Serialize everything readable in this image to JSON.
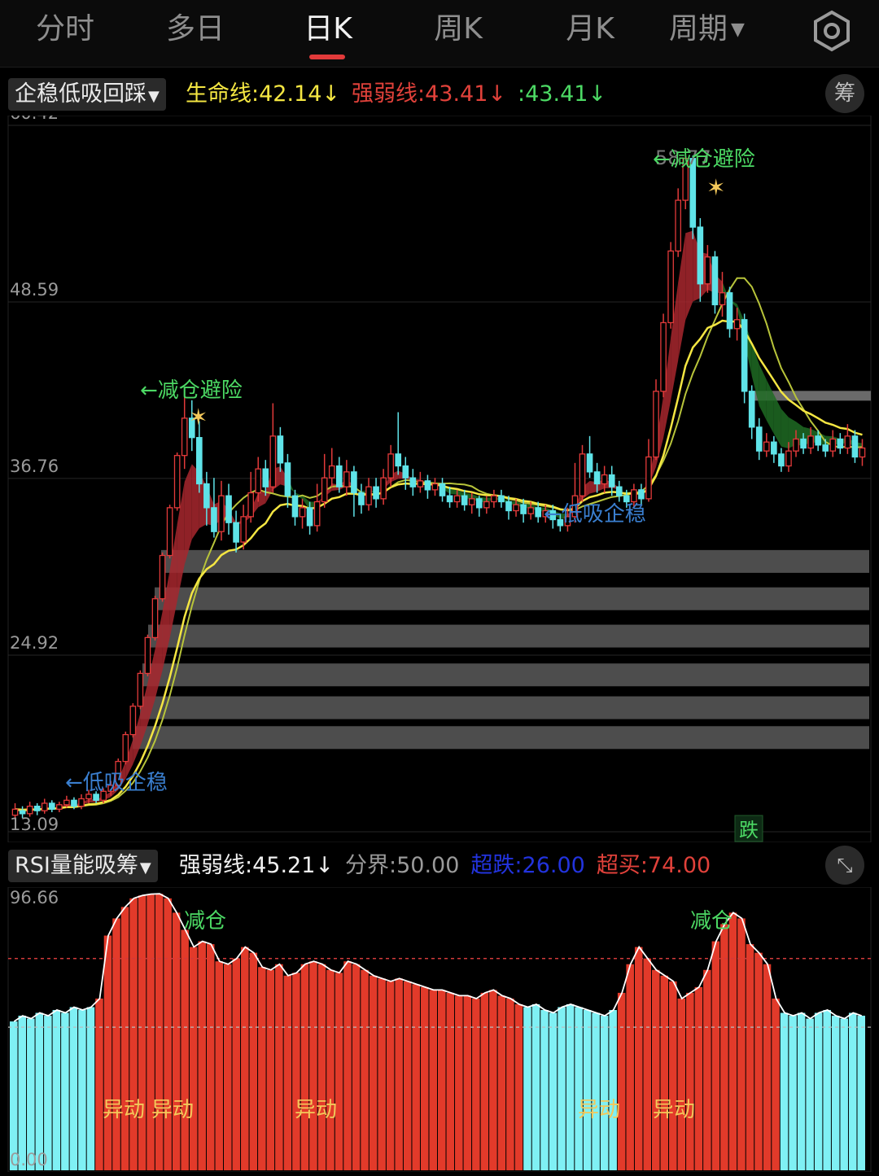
{
  "tabs": [
    {
      "label": "分时",
      "active": false
    },
    {
      "label": "多日",
      "active": false
    },
    {
      "label": "日K",
      "active": true
    },
    {
      "label": "周K",
      "active": false
    },
    {
      "label": "月K",
      "active": false
    },
    {
      "label": "周期",
      "active": false
    }
  ],
  "main_indicator": {
    "selector": "企稳低吸回踩",
    "values": [
      {
        "text": "生命线:42.14↓",
        "color": "#f4e642"
      },
      {
        "text": "强弱线:43.41↓",
        "color": "#e0413a"
      },
      {
        "text": ":43.41↓",
        "color": "#4cd964"
      }
    ],
    "chip_label": "筹"
  },
  "sub_indicator": {
    "selector": "RSI量能吸筹",
    "values": [
      {
        "text": "强弱线:45.21↓",
        "color": "#f0f0f0"
      },
      {
        "text": "分界:50.00",
        "color": "#9a9a9a"
      },
      {
        "text": "超跌:26.00",
        "color": "#2233dd"
      },
      {
        "text": "超买:74.00",
        "color": "#e0413a"
      }
    ]
  },
  "price_axis": [
    "60.42",
    "48.59",
    "36.76",
    "24.92",
    "13.09"
  ],
  "rsi_axis": [
    "96.66",
    "0.00"
  ],
  "annotations": {
    "high_price": "58.77",
    "reduce_label": "←减仓避险",
    "low_buy_label": "←低吸企稳",
    "fall_label": "跌",
    "rsi_reduce": "减仓",
    "rsi_move": "异动"
  },
  "chart_data": {
    "type": "candlestick",
    "price_range": [
      13.09,
      60.42
    ],
    "rsi_range": [
      0,
      96.66
    ],
    "rsi_levels": {
      "boundary": 50,
      "oversold": 26,
      "overbought": 74
    },
    "candles": [
      [
        14.2,
        14.6,
        15.0,
        13.9
      ],
      [
        14.5,
        14.3,
        14.8,
        14.0
      ],
      [
        14.3,
        14.8,
        15.1,
        14.1
      ],
      [
        14.8,
        14.5,
        15.0,
        14.2
      ],
      [
        14.5,
        15.0,
        15.3,
        14.3
      ],
      [
        15.0,
        14.6,
        15.2,
        14.4
      ],
      [
        14.6,
        14.9,
        15.1,
        14.4
      ],
      [
        14.9,
        15.2,
        15.5,
        14.7
      ],
      [
        15.2,
        14.8,
        15.4,
        14.6
      ],
      [
        14.8,
        15.3,
        15.6,
        14.6
      ],
      [
        15.3,
        15.6,
        15.9,
        15.0
      ],
      [
        15.6,
        15.2,
        15.8,
        15.0
      ],
      [
        15.2,
        15.8,
        16.0,
        15.0
      ],
      [
        15.8,
        16.2,
        16.5,
        15.5
      ],
      [
        16.2,
        17.8,
        18.0,
        16.0
      ],
      [
        17.8,
        19.6,
        19.8,
        17.6
      ],
      [
        19.6,
        21.5,
        21.7,
        19.4
      ],
      [
        21.5,
        23.7,
        23.9,
        21.3
      ],
      [
        23.7,
        26.1,
        26.3,
        23.5
      ],
      [
        26.1,
        28.7,
        28.9,
        25.9
      ],
      [
        28.7,
        31.6,
        31.8,
        28.5
      ],
      [
        31.6,
        34.8,
        35.0,
        31.4
      ],
      [
        34.8,
        38.3,
        38.5,
        34.6
      ],
      [
        38.3,
        40.8,
        42.6,
        37.4
      ],
      [
        40.8,
        39.5,
        42.0,
        38.6
      ],
      [
        39.5,
        36.4,
        40.6,
        35.8
      ],
      [
        36.4,
        34.8,
        37.2,
        33.6
      ],
      [
        34.8,
        33.2,
        36.8,
        32.8
      ],
      [
        33.2,
        35.6,
        36.6,
        32.6
      ],
      [
        35.6,
        33.8,
        36.4,
        33.0
      ],
      [
        33.8,
        32.5,
        34.6,
        31.8
      ],
      [
        32.5,
        34.2,
        35.0,
        32.0
      ],
      [
        34.2,
        35.8,
        37.2,
        33.8
      ],
      [
        35.8,
        37.4,
        38.2,
        35.2
      ],
      [
        37.4,
        36.2,
        38.0,
        35.6
      ],
      [
        36.2,
        39.6,
        41.8,
        35.8
      ],
      [
        39.6,
        37.8,
        40.2,
        37.2
      ],
      [
        37.8,
        35.6,
        38.4,
        34.8
      ],
      [
        35.6,
        34.2,
        36.0,
        33.6
      ],
      [
        34.2,
        34.8,
        35.4,
        33.4
      ],
      [
        34.8,
        33.6,
        35.2,
        33.0
      ],
      [
        33.6,
        35.2,
        36.4,
        33.2
      ],
      [
        35.2,
        36.8,
        38.4,
        34.8
      ],
      [
        36.8,
        37.6,
        38.8,
        36.2
      ],
      [
        37.6,
        36.2,
        38.2,
        35.8
      ],
      [
        36.2,
        37.2,
        38.0,
        35.6
      ],
      [
        37.2,
        35.8,
        37.6,
        34.2
      ],
      [
        35.8,
        35.0,
        36.4,
        34.4
      ],
      [
        35.0,
        36.2,
        36.8,
        34.6
      ],
      [
        36.2,
        35.4,
        36.8,
        34.8
      ],
      [
        35.4,
        36.8,
        37.4,
        35.0
      ],
      [
        36.8,
        38.4,
        39.0,
        36.2
      ],
      [
        38.4,
        37.6,
        41.2,
        37.0
      ],
      [
        37.6,
        36.8,
        38.2,
        36.0
      ],
      [
        36.8,
        36.2,
        37.4,
        35.6
      ],
      [
        36.2,
        36.6,
        37.2,
        35.8
      ],
      [
        36.6,
        36.0,
        37.0,
        35.4
      ],
      [
        36.0,
        36.4,
        36.8,
        35.6
      ],
      [
        36.4,
        35.6,
        36.8,
        35.2
      ],
      [
        35.6,
        35.2,
        36.2,
        34.8
      ],
      [
        35.2,
        35.6,
        36.0,
        34.8
      ],
      [
        35.6,
        35.0,
        36.0,
        34.6
      ],
      [
        35.0,
        35.4,
        35.8,
        34.4
      ],
      [
        35.4,
        34.8,
        35.6,
        34.2
      ],
      [
        34.8,
        35.2,
        35.6,
        34.4
      ],
      [
        35.2,
        35.6,
        36.0,
        34.8
      ],
      [
        35.6,
        35.2,
        36.0,
        34.8
      ],
      [
        35.2,
        34.6,
        35.6,
        34.0
      ],
      [
        34.6,
        35.0,
        35.4,
        34.2
      ],
      [
        35.0,
        34.4,
        35.4,
        33.8
      ],
      [
        34.4,
        34.8,
        35.2,
        34.0
      ],
      [
        34.8,
        34.2,
        35.2,
        33.8
      ],
      [
        34.2,
        34.6,
        35.0,
        33.8
      ],
      [
        34.6,
        34.0,
        35.0,
        33.4
      ],
      [
        34.0,
        33.6,
        34.4,
        33.2
      ],
      [
        33.6,
        34.2,
        34.8,
        33.2
      ],
      [
        34.2,
        35.6,
        37.8,
        33.8
      ],
      [
        35.6,
        38.4,
        39.0,
        35.2
      ],
      [
        38.4,
        37.2,
        39.6,
        36.8
      ],
      [
        37.2,
        36.4,
        37.8,
        35.8
      ],
      [
        36.4,
        37.0,
        37.6,
        35.8
      ],
      [
        37.0,
        36.2,
        37.6,
        35.6
      ],
      [
        36.2,
        35.6,
        36.6,
        35.2
      ],
      [
        35.6,
        35.2,
        36.0,
        34.8
      ],
      [
        35.2,
        36.0,
        36.4,
        34.8
      ],
      [
        36.0,
        35.4,
        36.4,
        35.0
      ],
      [
        35.4,
        38.2,
        39.4,
        35.2
      ],
      [
        38.2,
        42.6,
        43.4,
        38.0
      ],
      [
        42.6,
        47.2,
        47.8,
        42.2
      ],
      [
        47.2,
        52.0,
        52.6,
        46.8
      ],
      [
        52.0,
        55.4,
        56.2,
        51.6
      ],
      [
        55.4,
        58.2,
        58.77,
        54.8
      ],
      [
        58.2,
        53.6,
        58.4,
        52.8
      ],
      [
        53.6,
        49.8,
        54.2,
        48.6
      ],
      [
        49.8,
        51.6,
        52.4,
        49.2
      ],
      [
        51.6,
        48.4,
        52.0,
        47.8
      ],
      [
        48.4,
        49.2,
        50.6,
        47.6
      ],
      [
        49.2,
        46.8,
        49.6,
        46.2
      ],
      [
        46.8,
        47.4,
        48.2,
        46.0
      ],
      [
        47.4,
        42.6,
        47.8,
        41.8
      ],
      [
        42.6,
        40.2,
        43.0,
        39.4
      ],
      [
        40.2,
        38.6,
        40.8,
        38.0
      ],
      [
        38.6,
        39.2,
        39.8,
        38.2
      ],
      [
        39.2,
        38.4,
        39.6,
        37.8
      ],
      [
        38.4,
        37.6,
        38.8,
        37.2
      ],
      [
        37.6,
        38.6,
        39.2,
        37.2
      ],
      [
        38.6,
        39.4,
        40.0,
        38.2
      ],
      [
        39.4,
        38.8,
        39.8,
        38.4
      ],
      [
        38.8,
        39.6,
        40.2,
        38.4
      ],
      [
        39.6,
        39.0,
        40.0,
        38.6
      ],
      [
        39.0,
        38.6,
        39.4,
        38.2
      ],
      [
        38.6,
        39.4,
        40.0,
        38.2
      ],
      [
        39.4,
        38.8,
        39.8,
        38.4
      ],
      [
        38.8,
        39.6,
        40.4,
        38.4
      ],
      [
        39.6,
        38.2,
        40.0,
        37.8
      ],
      [
        38.2,
        38.8,
        39.4,
        37.6
      ]
    ],
    "rsi": [
      52,
      54,
      53,
      55,
      54,
      56,
      55,
      57,
      56,
      57,
      60,
      82,
      88,
      92,
      95,
      96,
      96.5,
      96.6,
      95,
      90,
      84,
      78,
      80,
      79,
      73,
      72,
      74,
      78,
      76,
      71,
      70,
      72,
      68,
      69,
      72,
      73,
      72,
      70,
      69,
      73,
      72,
      70,
      68,
      67,
      66,
      67,
      66,
      65,
      64,
      63,
      63,
      62,
      61,
      61,
      60,
      62,
      63,
      61,
      60,
      58,
      57,
      58,
      56,
      55,
      57,
      58,
      57,
      56,
      55,
      54,
      56,
      62,
      72,
      78,
      74,
      70,
      68,
      66,
      60,
      62,
      64,
      70,
      80,
      86,
      90,
      88,
      79,
      76,
      72,
      60,
      55,
      54,
      55,
      53,
      55,
      56,
      54,
      53,
      55,
      54
    ]
  }
}
